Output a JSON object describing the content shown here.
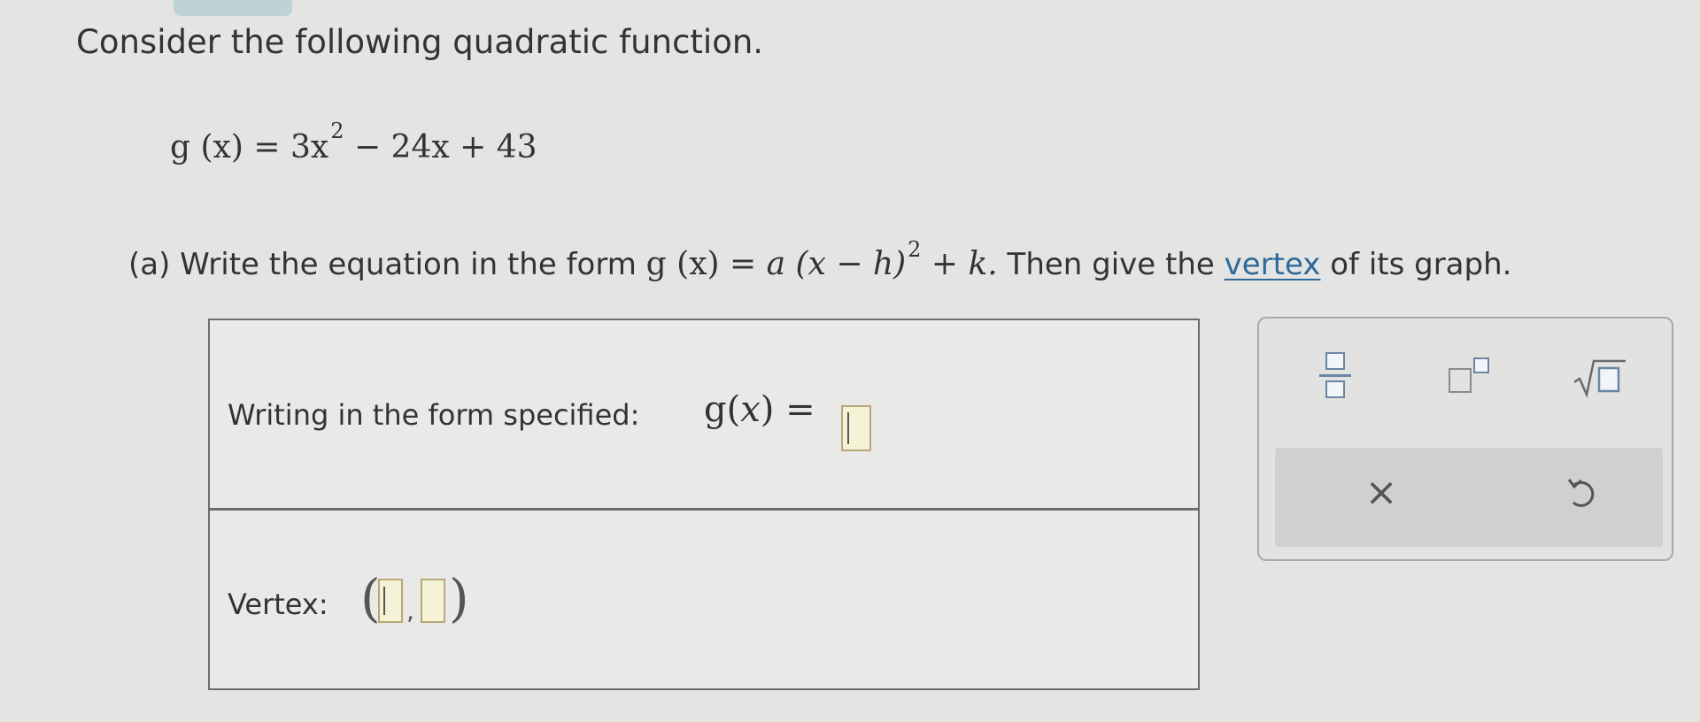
{
  "problem": {
    "prompt": "Consider the following quadratic function.",
    "equation": {
      "lhs": "g",
      "arg": "(x)",
      "eq_sign": "=",
      "coef": "3x",
      "exponent": "2",
      "rest": "− 24x + 43"
    }
  },
  "part_a": {
    "prefix": "(a) Write the equation in the form",
    "form_lhs": "g (x) = ",
    "form_a": "a",
    "form_paren": " (x − h)",
    "form_exponent": "2",
    "form_tail": " + k.",
    "then_text": " Then give the ",
    "vertex_link": "vertex",
    "suffix": " of its graph."
  },
  "answer_panel": {
    "form_label": "Writing in the form specified:",
    "form_lhs": "g",
    "form_arg": "x",
    "form_eq": "=",
    "form_value": "",
    "vertex_label": "Vertex:",
    "vertex_x": "",
    "vertex_y": "",
    "vertex_comma": ","
  },
  "toolbox": {
    "buttons": [
      {
        "name": "fraction",
        "icon": "fraction-icon"
      },
      {
        "name": "superscript",
        "icon": "superscript-icon"
      },
      {
        "name": "square-root",
        "icon": "square-root-icon"
      },
      {
        "name": "clear",
        "icon": "close-icon",
        "glyph": "×"
      },
      {
        "name": "undo",
        "icon": "undo-icon"
      }
    ]
  },
  "colors": {
    "background": "#e4e4e3",
    "text": "#333333",
    "link": "#2e6a99",
    "slot_fill": "#f5f2d6",
    "icon_blue": "#6a86a4"
  }
}
